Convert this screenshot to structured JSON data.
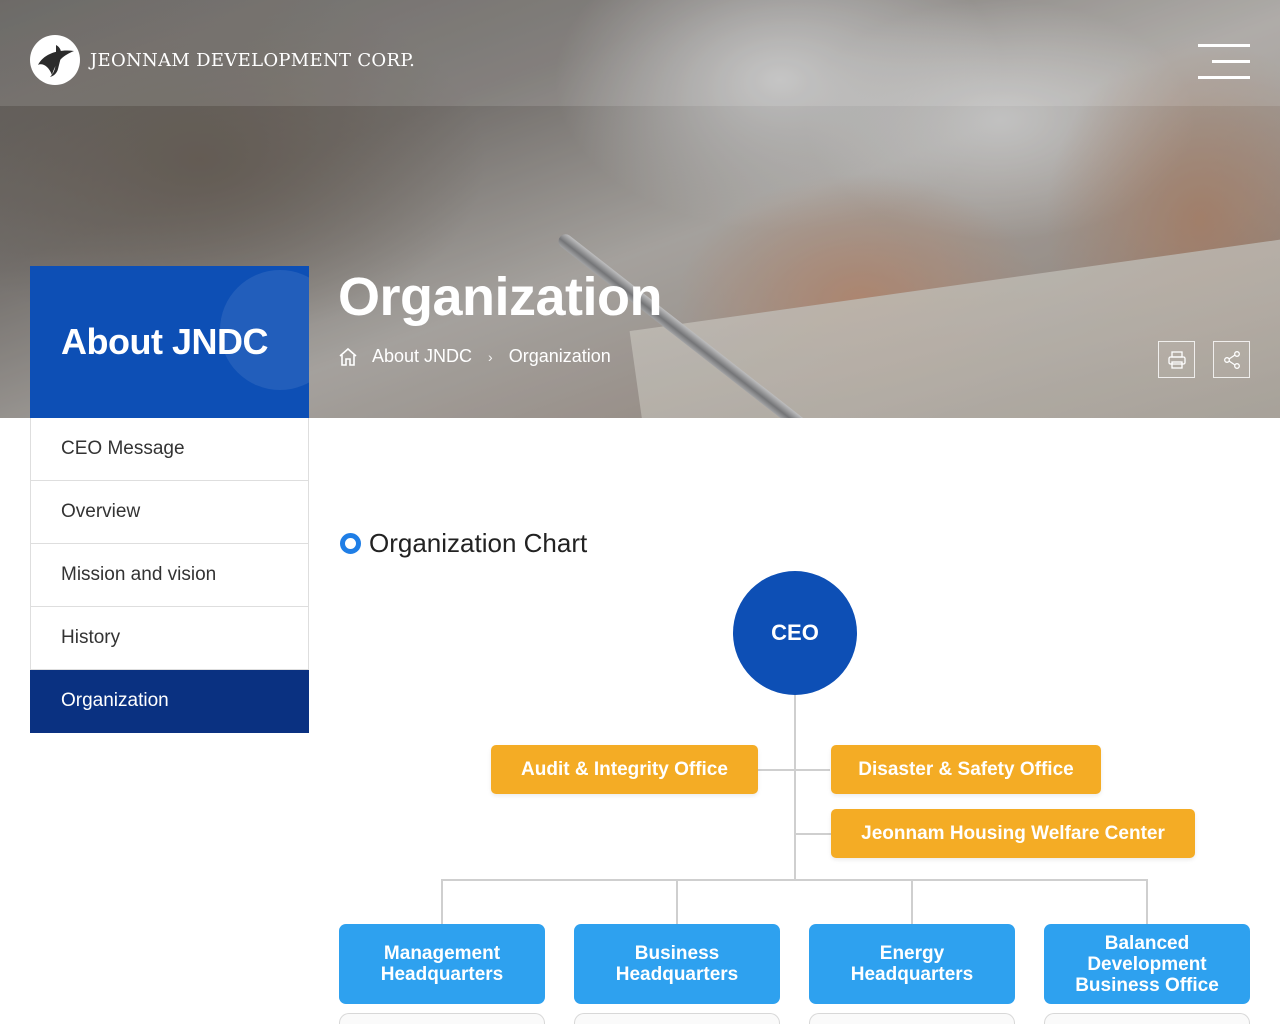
{
  "header": {
    "company_name": "JEONNAM DEVELOPMENT CORP.",
    "logo_icon": "jndc-logo-icon",
    "menu_icon": "hamburger-menu-icon"
  },
  "hero": {
    "page_title": "Organization",
    "breadcrumb": {
      "home_icon": "home-icon",
      "items": [
        "About JNDC",
        "Organization"
      ]
    },
    "tools": [
      "print-icon",
      "share-icon"
    ]
  },
  "sidebar": {
    "title": "About JNDC",
    "items": [
      {
        "label": "CEO Message",
        "active": false
      },
      {
        "label": "Overview",
        "active": false
      },
      {
        "label": "Mission and vision",
        "active": false
      },
      {
        "label": "History",
        "active": false
      },
      {
        "label": "Organization",
        "active": true
      }
    ]
  },
  "content": {
    "section_title": "Organization Chart",
    "org_chart": {
      "top": "CEO",
      "staff_offices": [
        "Audit & Integrity Office",
        "Disaster & Safety Office",
        "Jeonnam Housing Welfare Center"
      ],
      "headquarters": [
        [
          "Management",
          "Headquarters"
        ],
        [
          "Business",
          "Headquarters"
        ],
        [
          "Energy",
          "Headquarters"
        ],
        [
          "Balanced",
          "Development",
          "Business Office"
        ]
      ]
    }
  },
  "colors": {
    "primary_blue": "#0d4fb5",
    "active_nav": "#0a3181",
    "orange": "#f4ac25",
    "light_blue": "#2ea1ef",
    "accent_ring": "#1f7ee6"
  }
}
